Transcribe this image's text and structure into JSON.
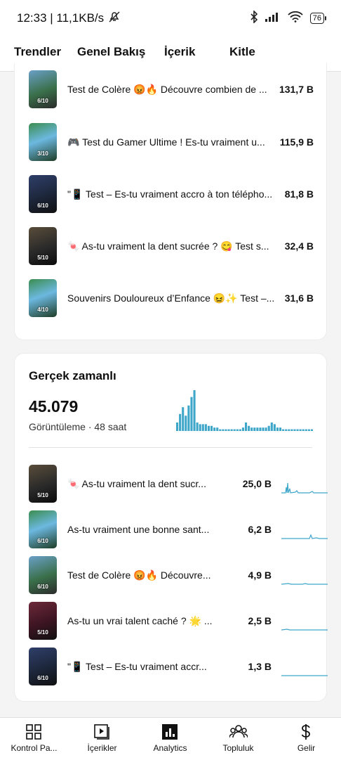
{
  "status_bar": {
    "time_speed": "12:33 | 11,1KB/s",
    "battery": "76"
  },
  "tabs": [
    {
      "label": "Trendler"
    },
    {
      "label": "Genel Bakış",
      "active": true
    },
    {
      "label": "İçerik"
    },
    {
      "label": "Kitle"
    }
  ],
  "top_videos": [
    {
      "thumb_label": "6/10",
      "title": "Test de Colère 😡🔥 Découvre combien de ...",
      "views": "131,7 B"
    },
    {
      "thumb_label": "3/10",
      "title": "🎮 Test du Gamer Ultime ! Es-tu vraiment u...",
      "views": "115,9 B"
    },
    {
      "thumb_label": "6/10",
      "title": "\"📱 Test – Es-tu vraiment accro à ton télépho...",
      "views": "81,8 B"
    },
    {
      "thumb_label": "5/10",
      "title": "🍬 As-tu vraiment la dent sucrée ? 😋 Test s...",
      "views": "32,4 B"
    },
    {
      "thumb_label": "4/10",
      "title": "Souvenirs Douloureux d’Enfance 😖✨ Test –...",
      "views": "31,6 B"
    }
  ],
  "realtime": {
    "title": "Gerçek zamanlı",
    "total": "45.079",
    "subtitle": "Görüntüleme · 48 saat",
    "accent_color": "#3ea6c9",
    "videos": [
      {
        "thumb_label": "5/10",
        "title": "🍬 As-tu vraiment la dent sucr...",
        "views": "25,0 B"
      },
      {
        "thumb_label": "6/10",
        "title": "As-tu vraiment une bonne sant...",
        "views": "6,2 B"
      },
      {
        "thumb_label": "6/10",
        "title": "Test de Colère 😡🔥 Découvre...",
        "views": "4,9 B"
      },
      {
        "thumb_label": "5/10",
        "title": "As-tu un vrai talent caché ? 🌟 ...",
        "views": "2,5 B"
      },
      {
        "thumb_label": "6/10",
        "title": "\"📱 Test – Es-tu vraiment accr...",
        "views": "1,3 B"
      }
    ]
  },
  "chart_data": {
    "type": "bar",
    "title": "",
    "values": [
      5,
      10,
      14,
      9,
      15,
      20,
      24,
      5,
      4,
      4,
      4,
      3,
      3,
      2,
      2,
      1,
      1,
      1,
      1,
      1,
      1,
      1,
      1,
      2,
      5,
      3,
      2,
      2,
      2,
      2,
      2,
      2,
      3,
      5,
      4,
      2,
      2,
      1,
      1,
      1,
      1,
      1,
      1,
      1,
      1,
      1,
      1,
      1
    ]
  },
  "bottom_nav": [
    {
      "label": "Kontrol Pa...",
      "icon": "dashboard-icon"
    },
    {
      "label": "İçerikler",
      "icon": "content-icon"
    },
    {
      "label": "Analytics",
      "icon": "analytics-icon",
      "active": true
    },
    {
      "label": "Topluluk",
      "icon": "community-icon"
    },
    {
      "label": "Gelir",
      "icon": "earn-icon"
    }
  ]
}
